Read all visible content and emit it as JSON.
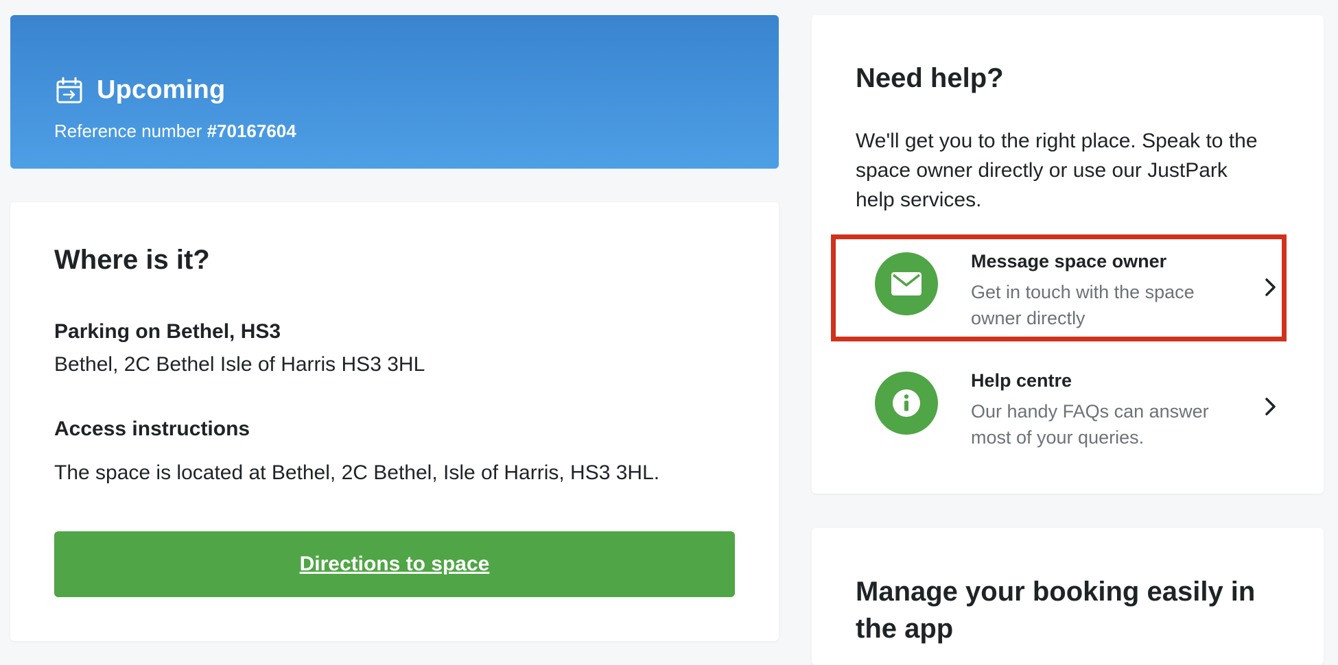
{
  "booking": {
    "status": "Upcoming",
    "reference_label": "Reference number",
    "reference_number": "#70167604"
  },
  "location": {
    "heading": "Where is it?",
    "parking_name": "Parking on Bethel, HS3",
    "address": "Bethel, 2C Bethel Isle of Harris HS3 3HL",
    "access_heading": "Access instructions",
    "access_text": "The space is located at Bethel, 2C Bethel, Isle of Harris, HS3 3HL.",
    "directions_label": "Directions to space"
  },
  "help": {
    "heading": "Need help?",
    "intro": "We'll get you to the right place. Speak to the space owner directly or use our JustPark help services.",
    "options": [
      {
        "title": "Message space owner",
        "description": "Get in touch with the space owner directly",
        "icon": "envelope-icon",
        "highlighted": true
      },
      {
        "title": "Help centre",
        "description": "Our handy FAQs can answer most of your queries.",
        "icon": "info-icon",
        "highlighted": false
      }
    ]
  },
  "app_promo": {
    "heading": "Manage your booking easily in the app"
  },
  "colors": {
    "banner_top": "#3a84cf",
    "banner_bottom": "#4d9fe6",
    "accent_green": "#50a546",
    "highlight_red": "#d0321c",
    "background": "#f5f7f9"
  }
}
